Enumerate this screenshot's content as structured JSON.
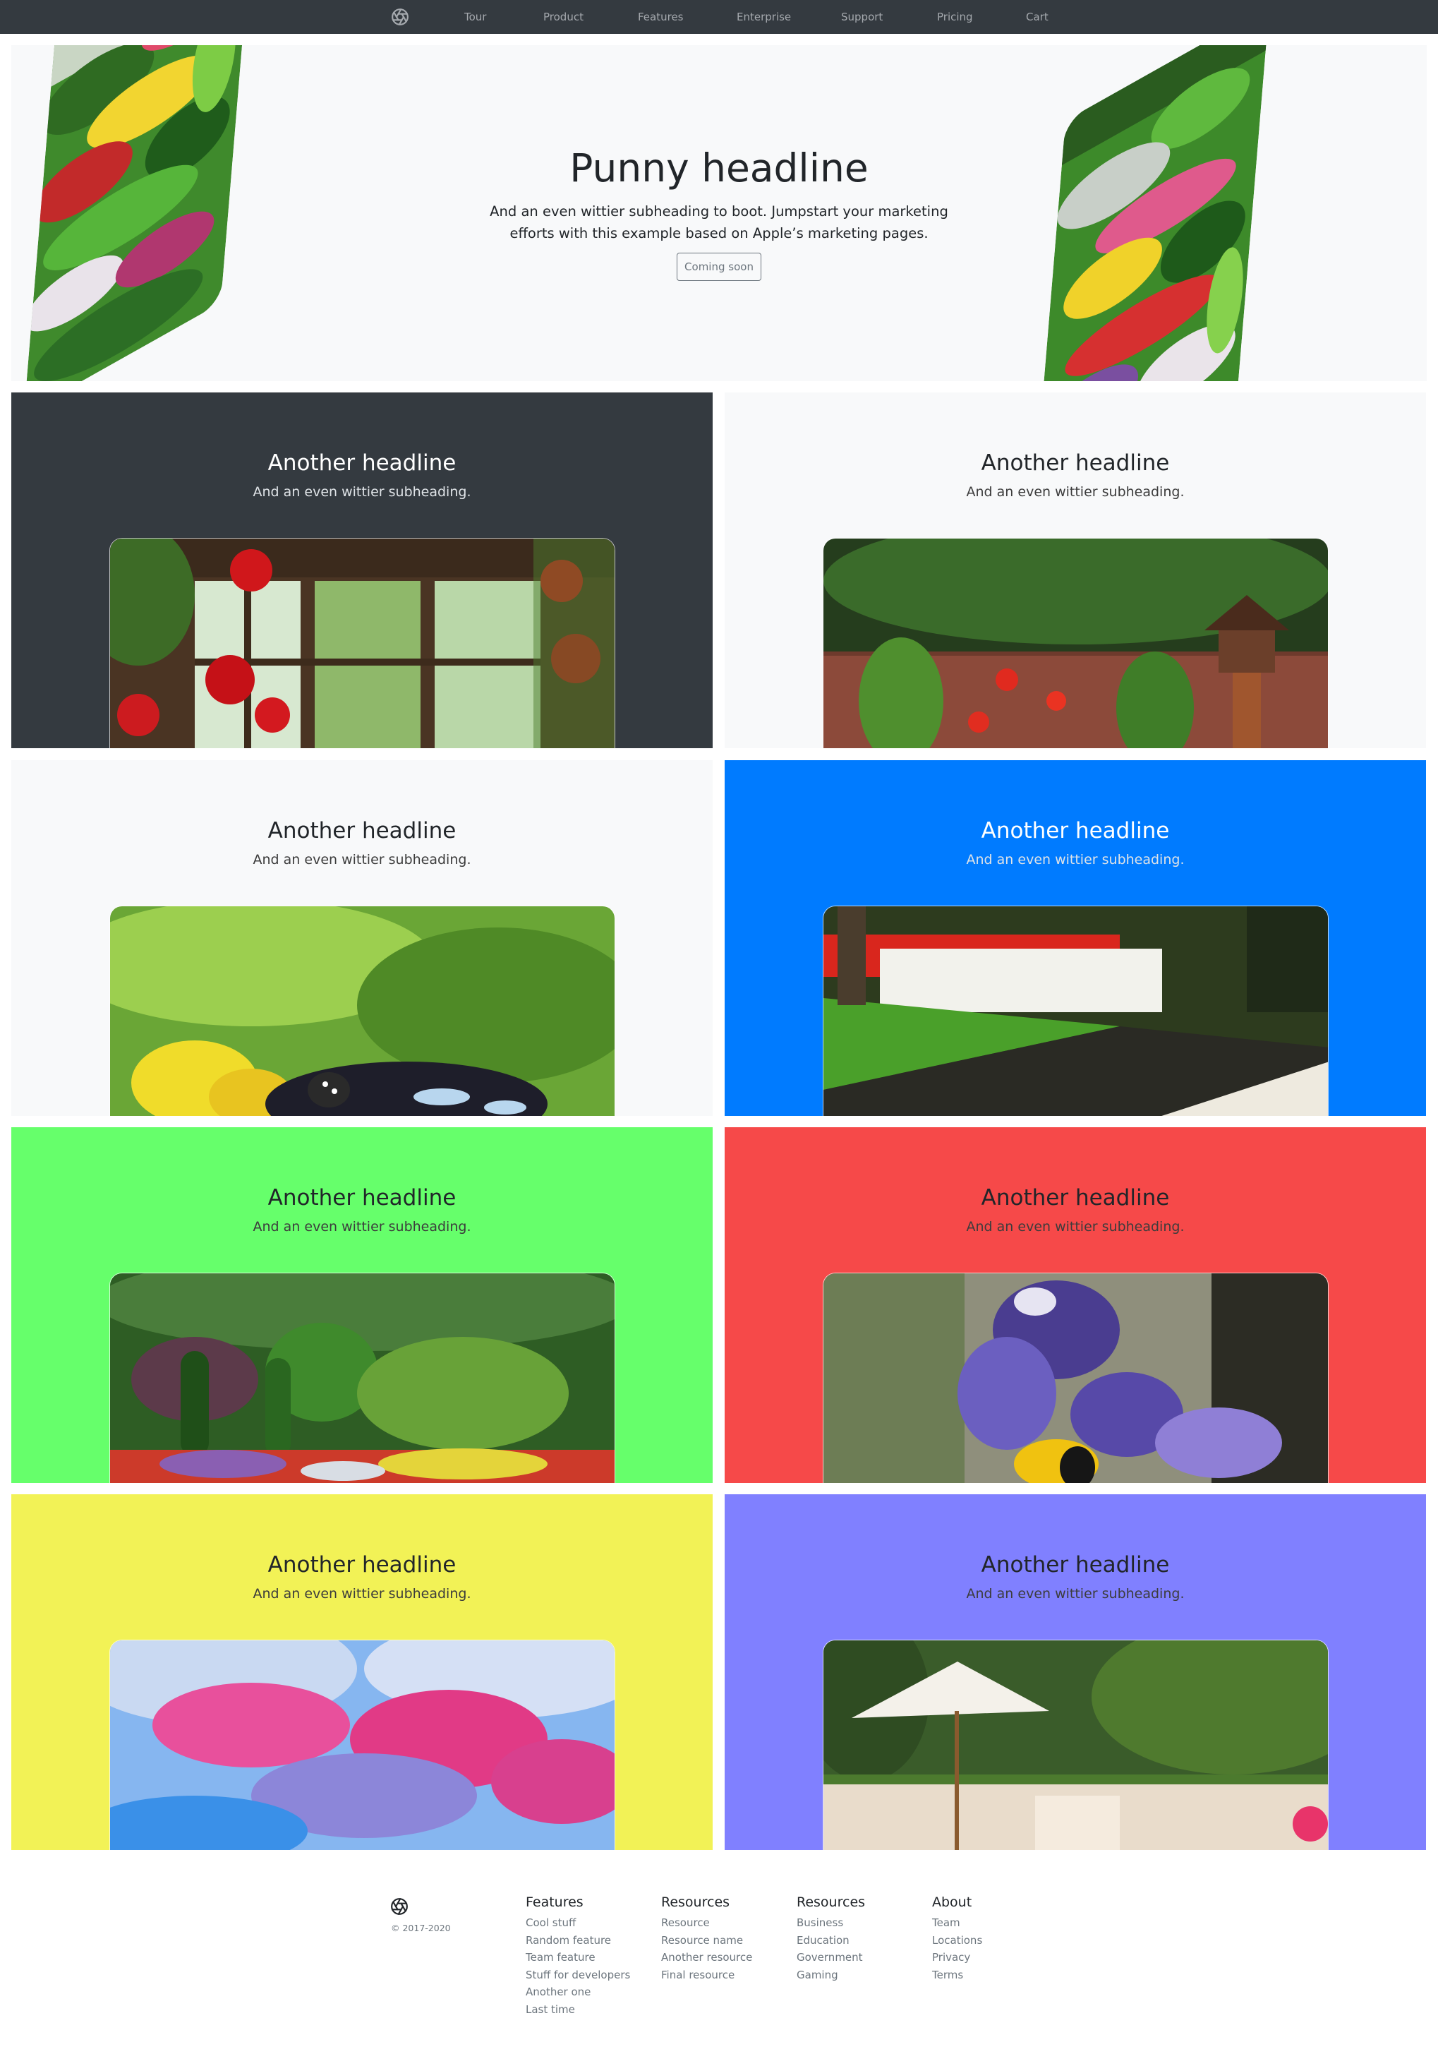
{
  "nav": {
    "logo_icon": "aperture-icon",
    "links": [
      "Tour",
      "Product",
      "Features",
      "Enterprise",
      "Support",
      "Pricing",
      "Cart"
    ]
  },
  "hero": {
    "title": "Punny headline",
    "subtitle": "And an even wittier subheading to boot. Jumpstart your marketing efforts with this example based on Apple’s marketing pages.",
    "button": "Coming soon"
  },
  "panels": [
    {
      "title": "Another headline",
      "subtitle": "And an even wittier subheading.",
      "bg": "#343a40",
      "photo": "window-geraniums"
    },
    {
      "title": "Another headline",
      "subtitle": "And an even wittier subheading.",
      "bg": "#f8f9fa",
      "photo": "garden-brick-wall"
    },
    {
      "title": "Another headline",
      "subtitle": "And an even wittier subheading.",
      "bg": "#f8f9fa",
      "photo": "butterfly-on-flower"
    },
    {
      "title": "Another headline",
      "subtitle": "And an even wittier subheading.",
      "bg": "#007bff",
      "photo": "tulips-canal"
    },
    {
      "title": "Another headline",
      "subtitle": "And an even wittier subheading.",
      "bg": "#66ff6b",
      "photo": "sunken-garden"
    },
    {
      "title": "Another headline",
      "subtitle": "And an even wittier subheading.",
      "bg": "#f64949",
      "photo": "bee-on-lavender"
    },
    {
      "title": "Another headline",
      "subtitle": "And an even wittier subheading.",
      "bg": "#f2f256",
      "photo": "blurred-pink-flowers"
    },
    {
      "title": "Another headline",
      "subtitle": "And an even wittier subheading.",
      "bg": "#8080ff",
      "photo": "patio-umbrella"
    }
  ],
  "footer": {
    "logo_icon": "aperture-icon",
    "copyright": "© 2017-2020",
    "columns": [
      {
        "heading": "Features",
        "links": [
          "Cool stuff",
          "Random feature",
          "Team feature",
          "Stuff for developers",
          "Another one",
          "Last time"
        ]
      },
      {
        "heading": "Resources",
        "links": [
          "Resource",
          "Resource name",
          "Another resource",
          "Final resource"
        ]
      },
      {
        "heading": "Resources",
        "links": [
          "Business",
          "Education",
          "Government",
          "Gaming"
        ]
      },
      {
        "heading": "About",
        "links": [
          "Team",
          "Locations",
          "Privacy",
          "Terms"
        ]
      }
    ]
  }
}
